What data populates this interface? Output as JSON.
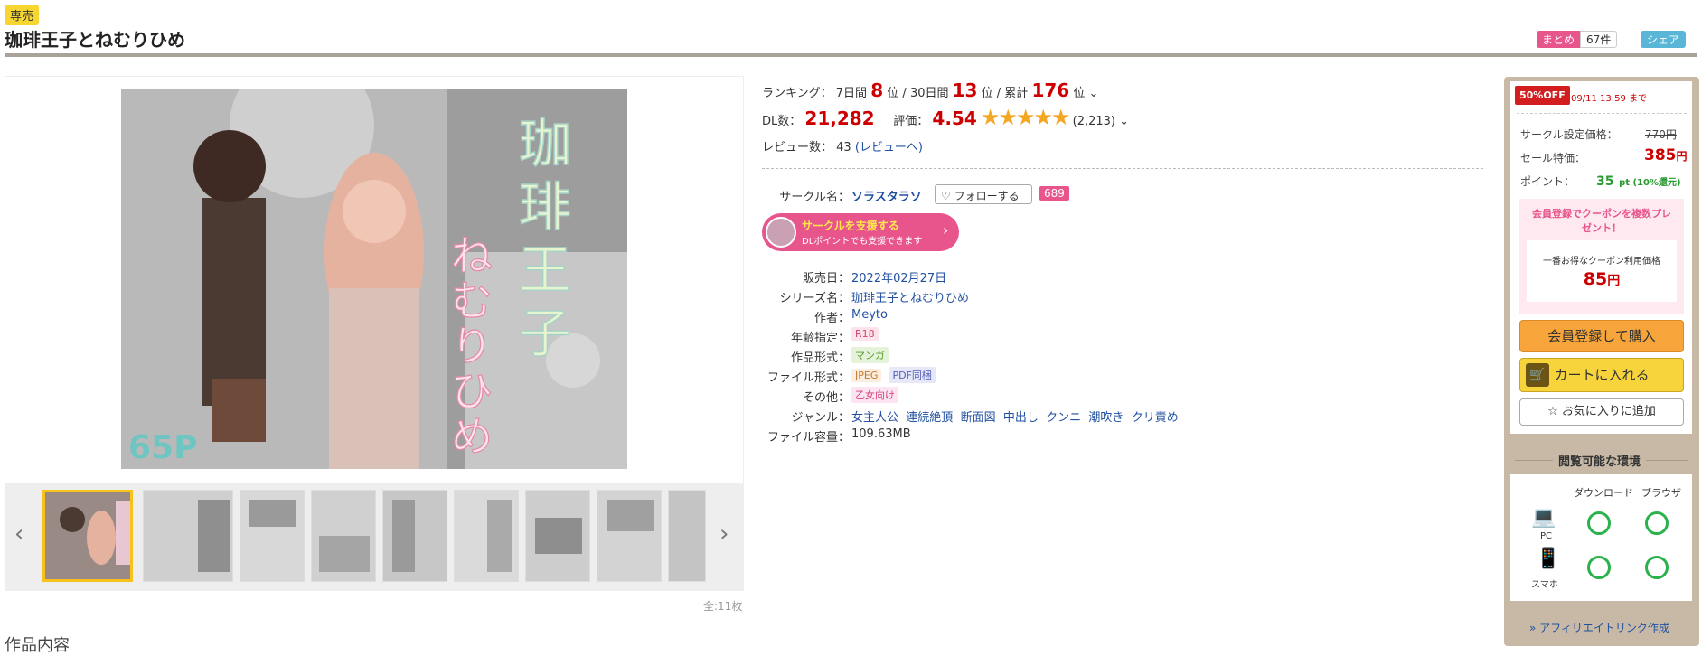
{
  "header": {
    "exclusive_label": "専売",
    "title": "珈琲王子とねむりひめ",
    "matome_label": "まとめ",
    "matome_count": "67件",
    "share_label": "シェア"
  },
  "gallery": {
    "cover_text_title": "珈琲王子とねむりひめ",
    "cover_text_pages": "65P",
    "page_count": "全:11枚",
    "prev_glyph": "‹",
    "next_glyph": "›"
  },
  "ranking": {
    "label": "ランキング：",
    "d7_label": "7日間",
    "d7_value": "8",
    "d30_label": "30日間",
    "d30_value": "13",
    "total_label": "累計",
    "total_value": "176",
    "unit": "位",
    "sep": "/"
  },
  "stats": {
    "dl_label": "DL数：",
    "dl_value": "21,282",
    "rating_label": "評価：",
    "rating_value": "4.54",
    "stars": "★★★★★",
    "rating_count": "(2,213)",
    "review_label": "レビュー数：",
    "review_count": "43",
    "review_link": "(レビューへ)"
  },
  "circle": {
    "label": "サークル名：",
    "name": "ソラスタラソ",
    "follow": "フォローする",
    "follow_count": "689",
    "support_main": "サークルを支援する",
    "support_sub": "DLポイントでも支援できます"
  },
  "details": {
    "release_label": "販売日：",
    "release_value": "2022年02月27日",
    "series_label": "シリーズ名：",
    "series_value": "珈琲王子とねむりひめ",
    "author_label": "作者：",
    "author_value": "Meyto",
    "age_label": "年齢指定：",
    "age_value": "R18",
    "format_label": "作品形式：",
    "format_value": "マンガ",
    "file_label": "ファイル形式：",
    "file_values": [
      "JPEG",
      "PDF同梱"
    ],
    "other_label": "その他：",
    "other_value": "乙女向け",
    "genre_label": "ジャンル：",
    "genres": [
      "女主人公",
      "連続絶頂",
      "断面図",
      "中出し",
      "クンニ",
      "潮吹き",
      "クリ責め"
    ],
    "size_label": "ファイル容量：",
    "size_value": "109.63MB"
  },
  "sale": {
    "off_badge": "50%OFF",
    "until": "09/11 13:59 まで",
    "circle_price_label": "サークル設定価格：",
    "circle_price": "770円",
    "sale_price_label": "セール特価：",
    "sale_price_num": "385",
    "sale_price_unit": "円",
    "point_label": "ポイント：",
    "point_num": "35",
    "point_unit": "pt (10%還元)",
    "coupon_headline": "会員登録でクーポンを複数プレゼント！",
    "coupon_label": "一番お得なクーポン利用価格",
    "coupon_price_num": "85",
    "coupon_price_unit": "円",
    "buy_button": "会員登録して購入",
    "cart_button": "カートに入れる",
    "fav_button": "お気に入りに追加"
  },
  "env": {
    "title": "閲覧可能な環境",
    "col_download": "ダウンロード",
    "col_browser": "ブラウザ",
    "row_pc": "PC",
    "row_phone": "スマホ",
    "affiliate": "» アフィリエイトリンク作成"
  },
  "sections": {
    "content_title": "作品内容"
  },
  "colors": {
    "accent_red": "#cc0000",
    "pink": "#e8558d",
    "yellow": "#f7d43c",
    "orange": "#f7a43b",
    "green": "#2bb24c"
  }
}
